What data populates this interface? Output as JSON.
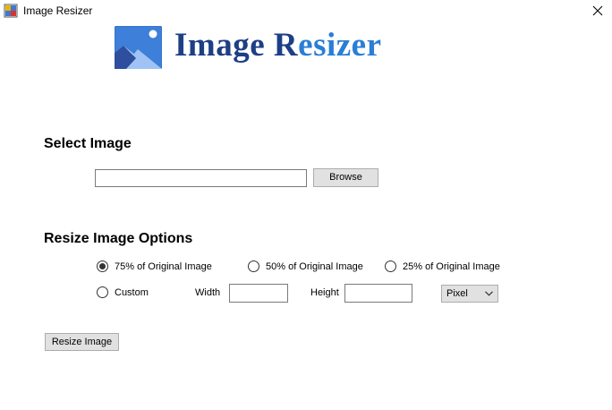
{
  "window": {
    "title": "Image Resizer",
    "close_glyph": "✕"
  },
  "logo": {
    "word1": "Image",
    "word2_first": "R",
    "word2_rest": "esizer",
    "colors": {
      "dark": "#1d3f86",
      "light": "#2a7ed6"
    },
    "icon": "landscape-image-icon"
  },
  "select_section": {
    "heading": "Select Image",
    "file_path_value": "",
    "browse_label": "Browse"
  },
  "options_section": {
    "heading": "Resize Image Options",
    "radio_75": "75% of Original Image",
    "radio_50": "50% of Original Image",
    "radio_25": "25% of Original Image",
    "radio_custom": "Custom",
    "selected": "75% of Original Image",
    "width_label": "Width",
    "height_label": "Height",
    "width_value": "",
    "height_value": "",
    "unit_selected": "Pixel"
  },
  "resize_button_label": "Resize Image"
}
